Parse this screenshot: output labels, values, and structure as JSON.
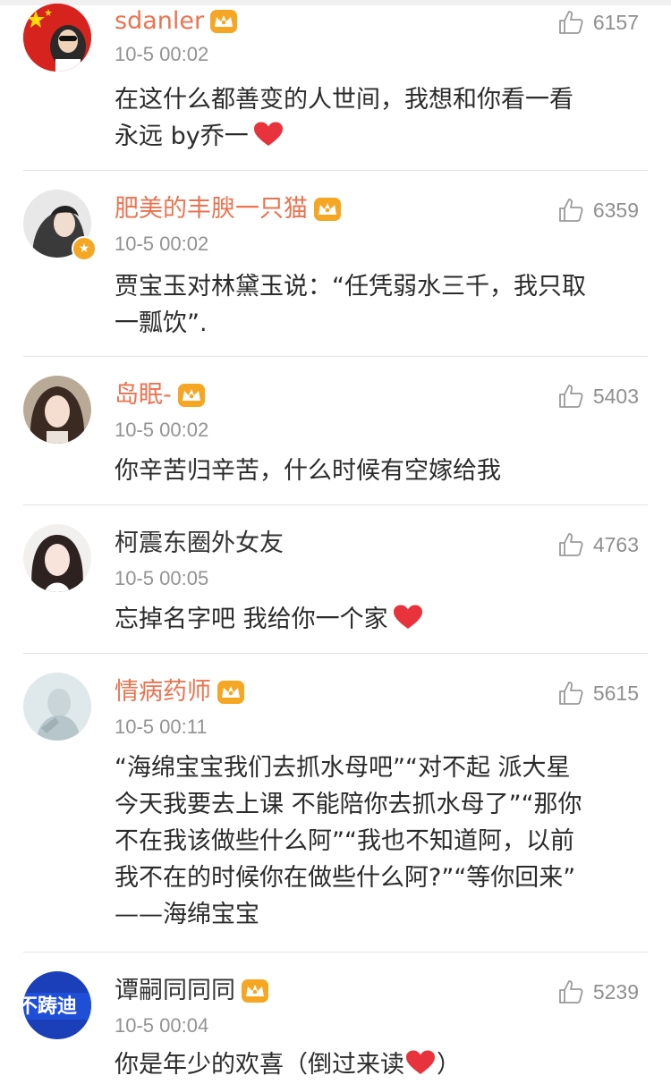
{
  "colors": {
    "vip_name": "#eb7350",
    "normal_name": "#333333",
    "time": "#939393",
    "like": "#8f8f8f",
    "heart": "#e8323c",
    "crown": "#f5a623"
  },
  "comments": [
    {
      "user": "sdanler",
      "time": "10-5 00:02",
      "likes": "6157",
      "text_lines": [
        "在这什么都善变的人世间，我想和你看一看",
        "永远  by乔一"
      ],
      "heart": true
    },
    {
      "user": "肥美的丰腴一只猫",
      "time": "10-5 00:02",
      "likes": "6359",
      "text_lines": [
        "贾宝玉对林黛玉说：“任凭弱水三千，我只取",
        "一瓢饮”."
      ]
    },
    {
      "user": "岛眠-",
      "time": "10-5 00:02",
      "likes": "5403",
      "text_lines": [
        "你辛苦归辛苦，什么时候有空嫁给我"
      ]
    },
    {
      "user": "柯震东圈外女友",
      "time": "10-5 00:05",
      "likes": "4763",
      "text_lines": [
        "忘掉名字吧 我给你一个家"
      ],
      "heart": true
    },
    {
      "user": "情病药师",
      "time": "10-5 00:11",
      "likes": "5615",
      "text_lines": [
        "“海绵宝宝我们去抓水母吧”“对不起 派大星",
        "今天我要去上课 不能陪你去抓水母了”“那你",
        "不在我该做些什么阿”“我也不知道阿，以前",
        "我不在的时候你在做些什么阿?”“等你回来”",
        "——海绵宝宝"
      ]
    },
    {
      "user": "谭嗣同同同",
      "time": "10-5 00:04",
      "likes": "5239",
      "text_before": "你是年少的欢喜（倒过来读",
      "text_after": "）",
      "avatar_text": "不踌迪"
    }
  ]
}
